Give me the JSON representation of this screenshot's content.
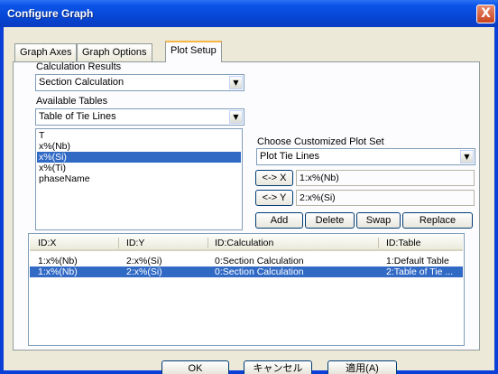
{
  "window": {
    "title": "Configure Graph",
    "close_glyph": "X"
  },
  "tabs": [
    {
      "label": "Graph Axes"
    },
    {
      "label": "Graph Options"
    },
    {
      "label": "Plot Setup"
    }
  ],
  "calc_results": {
    "label": "Calculation Results",
    "value": "Section Calculation"
  },
  "available_tables": {
    "label": "Available Tables",
    "value": "Table of Tie Lines"
  },
  "columns_list": [
    {
      "label": "T",
      "selected": false
    },
    {
      "label": "x%(Nb)",
      "selected": false
    },
    {
      "label": "x%(Si)",
      "selected": true
    },
    {
      "label": "x%(Ti)",
      "selected": false
    },
    {
      "label": "phaseName",
      "selected": false
    }
  ],
  "plot_set": {
    "label": "Choose Customized Plot Set",
    "value": "Plot Tie Lines"
  },
  "axis_x": {
    "button": "<-> X",
    "value": "1:x%(Nb)"
  },
  "axis_y": {
    "button": "<-> Y",
    "value": "2:x%(Si)"
  },
  "actions": {
    "add": "Add",
    "delete": "Delete",
    "swap": "Swap",
    "replace": "Replace"
  },
  "table": {
    "headers": [
      "ID:X",
      "ID:Y",
      "ID:Calculation",
      "ID:Table"
    ],
    "rows": [
      {
        "x": "1:x%(Nb)",
        "y": "2:x%(Si)",
        "calc": "0:Section Calculation",
        "table": "1:Default Table",
        "selected": false
      },
      {
        "x": "1:x%(Nb)",
        "y": "2:x%(Si)",
        "calc": "0:Section Calculation",
        "table": "2:Table of Tie ...",
        "selected": true
      }
    ]
  },
  "dialog_buttons": {
    "ok": "OK",
    "cancel": "キャンセル",
    "apply": "適用(A)"
  },
  "colors": {
    "title_bar": "#0b54e8",
    "selection": "#316ac5",
    "dialog_bg": "#ece9d8",
    "active_tab_accent": "#f7b64a"
  }
}
